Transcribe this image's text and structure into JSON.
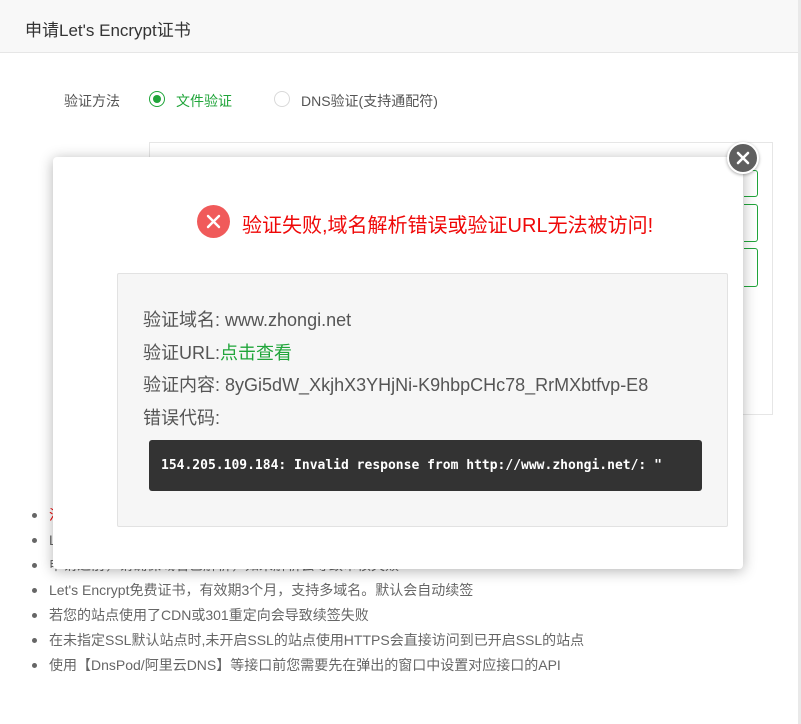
{
  "dialog": {
    "title": "申请Let's Encrypt证书",
    "method_label": "验证方法",
    "options": [
      {
        "label": "文件验证",
        "selected": true
      },
      {
        "label": "DNS验证(支持通配符)",
        "selected": false
      }
    ],
    "notes": [
      "注",
      "L",
      "申请之前，请确保域名已解析，如未解析会导致审核失败",
      "Let's Encrypt免费证书，有效期3个月，支持多域名。默认会自动续签",
      "若您的站点使用了CDN或301重定向会导致续签失败",
      "在未指定SSL默认站点时,未开启SSL的站点使用HTTPS会直接访问到已开启SSL的站点",
      "使用【DnsPod/阿里云DNS】等接口前您需要先在弹出的窗口中设置对应接口的API"
    ]
  },
  "error_popup": {
    "message": "验证失败,域名解析错误或验证URL无法被访问!",
    "domain_key": "验证域名:",
    "domain_value": "www.zhongi.net",
    "url_key": "验证URL:",
    "url_value": "点击查看",
    "content_key": "验证内容:",
    "content_value": "8yGi5dW_XkjhX3YHjNi-K9hbpCHc78_RrMXbtfvp-E8",
    "error_code_key": "错误代码:",
    "error_code_text": "154.205.109.184: Invalid response from http://www.zhongi.net/: \""
  },
  "colors": {
    "accent_green": "#20a53a",
    "error_red": "#ef0808",
    "error_icon": "#f05a5a",
    "code_bg": "#333333"
  }
}
